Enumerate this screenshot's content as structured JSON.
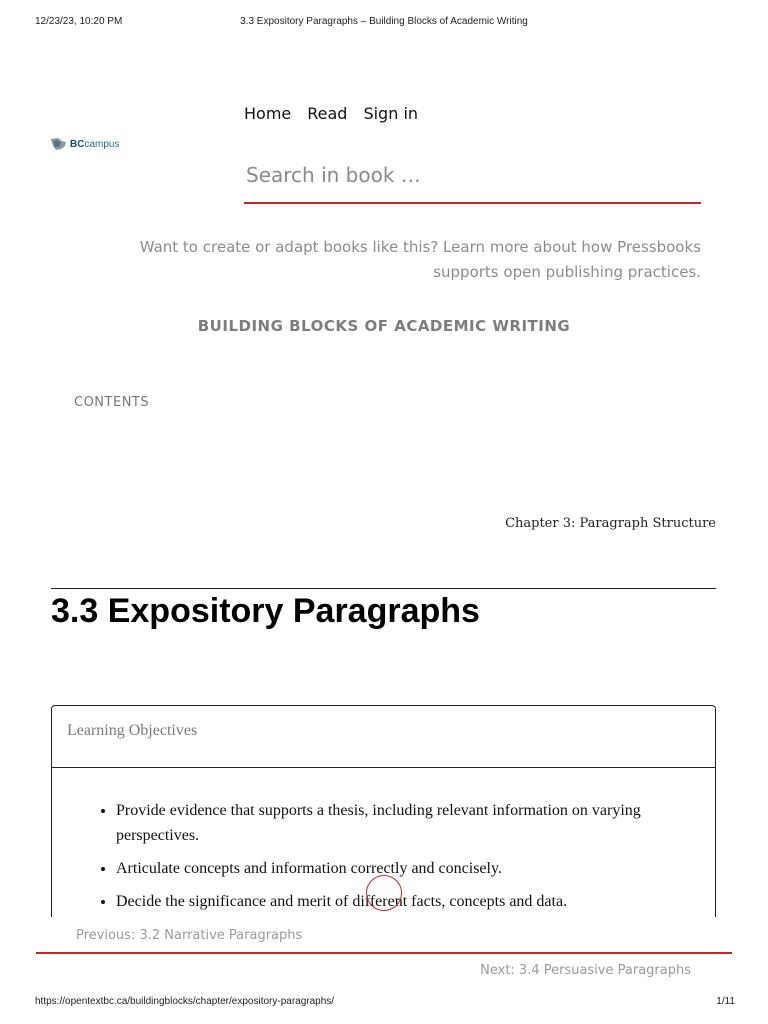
{
  "print_header": {
    "datetime": "12/23/23, 10:20 PM",
    "page_title": "3.3 Expository Paragraphs – Building Blocks of Academic Writing"
  },
  "logo": {
    "text_bold": "BC",
    "text_rest": "campus"
  },
  "nav": {
    "home": "Home",
    "read": "Read",
    "sign_in": "Sign in"
  },
  "search": {
    "placeholder": "Search in book …"
  },
  "pressbooks_notice": "Want to create or adapt books like this? Learn more about how Pressbooks supports open publishing practices.",
  "book_title": "BUILDING BLOCKS OF ACADEMIC WRITING",
  "contents_label": "CONTENTS",
  "chapter_label": "Chapter 3: Paragraph Structure",
  "page_heading": "3.3 Expository Paragraphs",
  "learning_objectives": {
    "title": "Learning Objectives",
    "items": [
      "Provide evidence that supports a thesis, including relevant information on varying perspectives.",
      "Articulate concepts and information correctly and concisely.",
      "Decide the significance and merit of different facts, concepts and data."
    ]
  },
  "pagination": {
    "previous": "Previous: 3.2 Narrative Paragraphs",
    "next": "Next: 3.4 Persuasive Paragraphs"
  },
  "print_footer": {
    "url": "https://opentextbc.ca/buildingblocks/chapter/expository-paragraphs/",
    "page_count": "1/11"
  },
  "colors": {
    "accent": "#c0282d",
    "brand": "#1a6f8e"
  }
}
